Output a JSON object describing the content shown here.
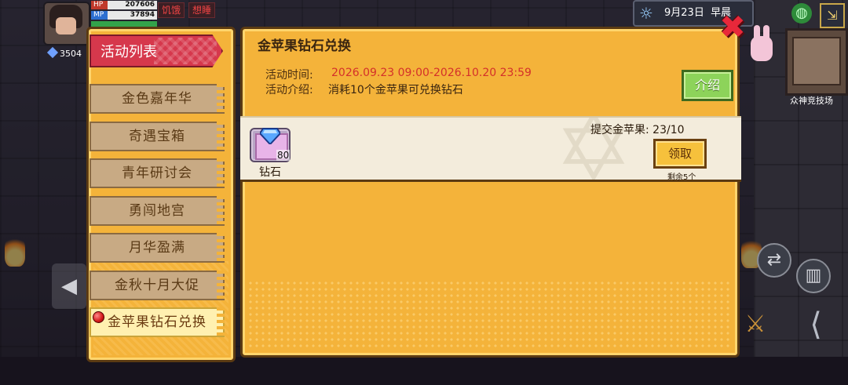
{
  "hud": {
    "hp_label": "HP",
    "hp_value": "207606",
    "mp_label": "MP",
    "mp_value": "37894",
    "status_hunger": "饥饿",
    "status_sleepy": "想睡",
    "gems": "3504",
    "date": "9月23日",
    "time_of_day": "早晨",
    "map_name": "众神竞技场"
  },
  "sidebar": {
    "header": "活动列表",
    "items": [
      {
        "label": "金色嘉年华"
      },
      {
        "label": "奇遇宝箱"
      },
      {
        "label": "青年研讨会"
      },
      {
        "label": "勇闯地宫"
      },
      {
        "label": "月华盈满"
      },
      {
        "label": "金秋十月大促"
      },
      {
        "label": "金苹果钻石兑换"
      }
    ]
  },
  "event": {
    "title": "金苹果钻石兑换",
    "time_label": "活动时间:",
    "time_value": "2026.09.23 09:00-2026.10.20 23:59",
    "desc_label": "活动介绍:",
    "desc_value": "消耗10个金苹果可兑换钻石",
    "intro_button": "介绍"
  },
  "reward": {
    "item_name": "钻石",
    "item_count": "80",
    "submit_label": "提交金苹果:",
    "submit_progress": "23/10",
    "claim_button": "领取",
    "remaining": "剩余5个"
  },
  "colors": {
    "panel": "#f4b33a",
    "header_red": "#d6384c",
    "time_red": "#d4302a",
    "intro_green": "#8dd35a",
    "claim_gold": "#f6c13c"
  }
}
